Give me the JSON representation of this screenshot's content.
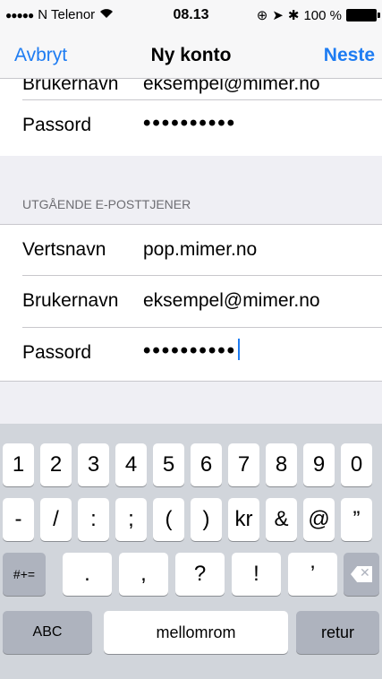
{
  "status": {
    "carrier": "N Telenor",
    "time": "08.13",
    "battery": "100 %"
  },
  "nav": {
    "cancel": "Avbryt",
    "title": "Ny konto",
    "next": "Neste"
  },
  "incoming_partial": {
    "username_label": "Brukernavn",
    "username_value": "eksempel@mimer.no"
  },
  "incoming": {
    "password_label": "Passord",
    "password_dots": "••••••••••"
  },
  "outgoing": {
    "header": "UTGÅENDE E-POSTTJENER",
    "host_label": "Vertsnavn",
    "host_value": "pop.mimer.no",
    "username_label": "Brukernavn",
    "username_value": "eksempel@mimer.no",
    "password_label": "Passord",
    "password_dots": "••••••••••"
  },
  "keyboard": {
    "row1": [
      "1",
      "2",
      "3",
      "4",
      "5",
      "6",
      "7",
      "8",
      "9",
      "0"
    ],
    "row2": [
      "-",
      "/",
      ":",
      ";",
      "(",
      ")",
      "kr",
      "&",
      "@",
      "”"
    ],
    "row3": [
      "#+=",
      ".",
      ",",
      "?",
      "!",
      "’"
    ],
    "abc": "ABC",
    "space": "mellomrom",
    "return": "retur"
  }
}
